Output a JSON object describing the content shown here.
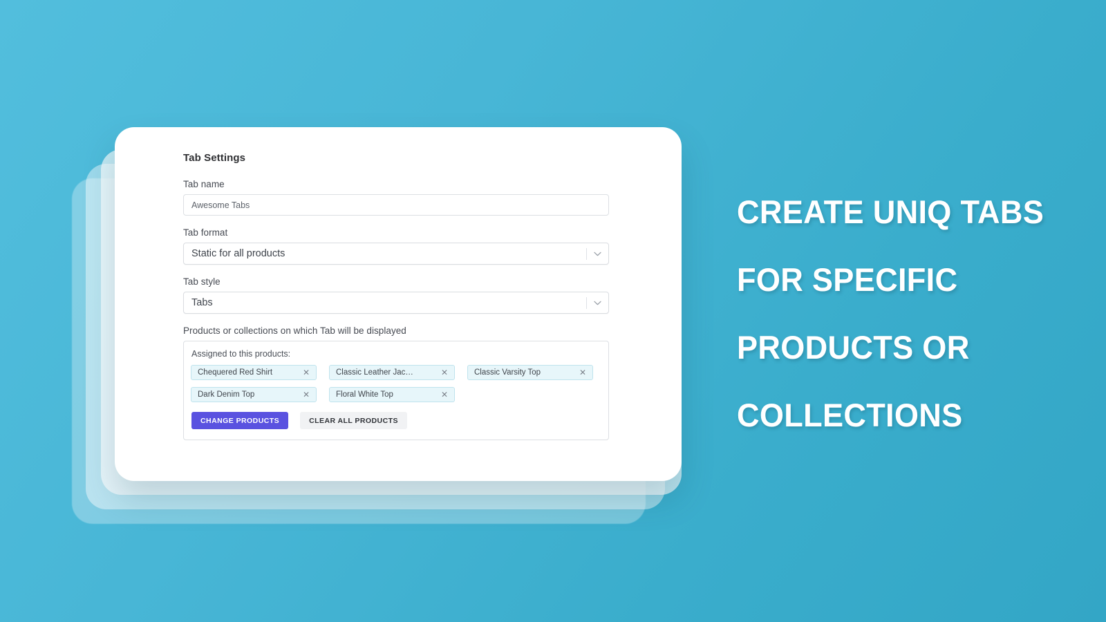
{
  "background": {
    "gradient_from": "#52bedd",
    "gradient_to": "#33a6c6"
  },
  "card": {
    "title": "Tab Settings",
    "fields": {
      "tab_name": {
        "label": "Tab name",
        "value": "Awesome Tabs"
      },
      "tab_format": {
        "label": "Tab format",
        "value": "Static for all products"
      },
      "tab_style": {
        "label": "Tab style",
        "value": "Tabs"
      }
    },
    "products_section": {
      "label": "Products or collections on which Tab will be displayed",
      "assigned_title": "Assigned to this products:",
      "tags": [
        {
          "label": "Chequered Red Shirt",
          "remove_icon": "close-icon"
        },
        {
          "label": "Classic Leather Jac…",
          "remove_icon": "close-icon"
        },
        {
          "label": "Classic Varsity Top",
          "remove_icon": "close-icon"
        },
        {
          "label": "Dark Denim Top",
          "remove_icon": "close-icon"
        },
        {
          "label": "Floral White Top",
          "remove_icon": "close-icon"
        }
      ],
      "tag_colors": {
        "background": "#e7f6fa",
        "border": "#bfe3ed"
      },
      "buttons": {
        "change_products": "CHANGE PRODUCTS",
        "clear_all_products": "CLEAR ALL PRODUCTS",
        "primary_color": "#5a52e0",
        "secondary_color": "#f1f2f4"
      }
    },
    "select_icon": "chevron-down-icon"
  },
  "headline": {
    "lines": [
      "CREATE UNIQ TABS",
      "FOR SPECIFIC",
      "PRODUCTS OR",
      "COLLECTIONS"
    ],
    "color": "#ffffff"
  }
}
